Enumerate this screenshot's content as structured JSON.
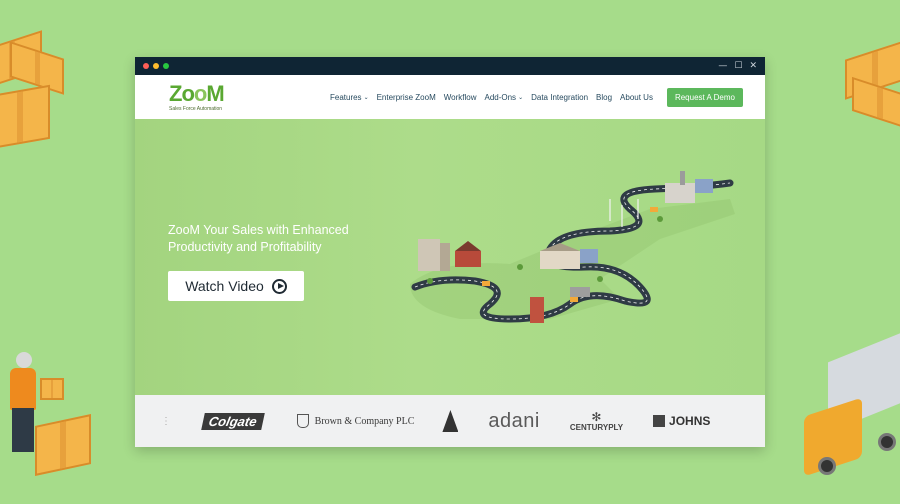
{
  "window": {
    "dots": [
      "#ff5f57",
      "#ffbd2e",
      "#28c840"
    ],
    "controls": {
      "minimize": "—",
      "maximize": "☐",
      "close": "✕"
    }
  },
  "brand": {
    "name_part1": "Zo",
    "name_o": "o",
    "name_part2": "M",
    "tagline": "Sales Force Automation",
    "color": "#5aa832"
  },
  "nav": {
    "items": [
      {
        "label": "Features",
        "has_dropdown": true
      },
      {
        "label": "Enterprise ZooM",
        "has_dropdown": false
      },
      {
        "label": "Workflow",
        "has_dropdown": false
      },
      {
        "label": "Add-Ons",
        "has_dropdown": true
      },
      {
        "label": "Data Integration",
        "has_dropdown": false
      },
      {
        "label": "Blog",
        "has_dropdown": false
      },
      {
        "label": "About Us",
        "has_dropdown": false
      }
    ],
    "cta": "Request A Demo"
  },
  "hero": {
    "title_line1": "ZooM Your Sales with Enhanced",
    "title_line2": "Productivity and Profitability",
    "button": "Watch Video"
  },
  "clients": {
    "colgate": "Colgate",
    "brown": "Brown & Company PLC",
    "adani": "adani",
    "centuryply": "CENTURYPLY",
    "johns": "JOHNS"
  },
  "colors": {
    "background": "#a6dc8a",
    "titlebar": "#0f2534",
    "cta": "#5cb85c",
    "hero_bg": "#addc8a"
  },
  "icons": [
    "chevron-down-icon",
    "play-icon",
    "minimize-icon",
    "maximize-icon",
    "close-icon"
  ]
}
